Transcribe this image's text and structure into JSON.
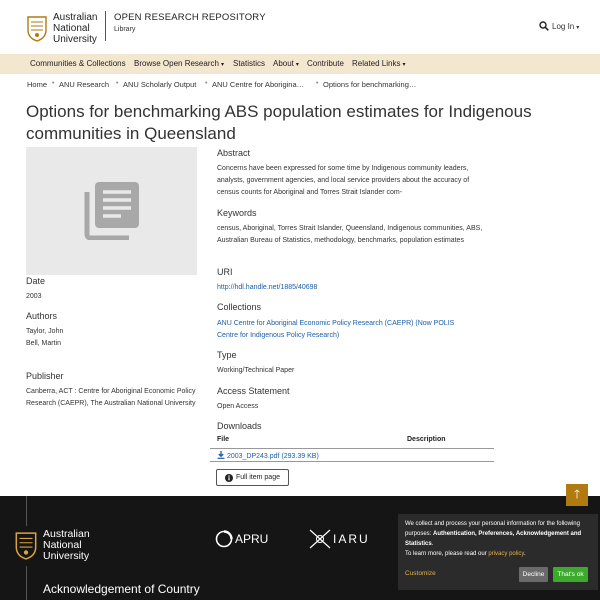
{
  "header": {
    "institution_line1": "Australian",
    "institution_line2": "National",
    "institution_line3": "University",
    "repo_title": "OPEN RESEARCH REPOSITORY",
    "repo_subtitle": "Library",
    "login_label": "Log In"
  },
  "nav": {
    "items": [
      "Communities & Collections",
      "Browse Open Research",
      "Statistics",
      "About",
      "Contribute",
      "Related Links"
    ]
  },
  "breadcrumb": [
    "Home",
    "ANU Research",
    "ANU Scholarly Output",
    "ANU Centre for Aborigina…",
    "Options for benchmarking…"
  ],
  "item": {
    "title": "Options for benchmarking ABS population estimates for Indigenous communities in Queensland",
    "date_label": "Date",
    "date": "2003",
    "authors_label": "Authors",
    "authors": [
      "Taylor, John",
      "Bell, Martin"
    ],
    "publisher_label": "Publisher",
    "publisher": "Canberra, ACT : Centre for Aboriginal Economic Policy Research (CAEPR), The Australian National University",
    "abstract_label": "Abstract",
    "abstract": "Concerns have been expressed for some time by Indigenous community leaders, analysts, government agencies, and local service providers about the accuracy of census counts for Aboriginal and Torres Strait Islander com-",
    "keywords_label": "Keywords",
    "keywords": "census, Aboriginal, Torres Strait Islander, Queensland, Indigenous communities, ABS, Australian Bureau of Statistics, methodology, benchmarks, population estimates",
    "uri_label": "URI",
    "uri": "http://hdl.handle.net/1885/40698",
    "collections_label": "Collections",
    "collection": "ANU Centre for Aboriginal Economic Policy Research (CAEPR) (Now POLIS Centre for Indigenous Policy Research)",
    "type_label": "Type",
    "type": "Working/Technical Paper",
    "access_label": "Access Statement",
    "access": "Open Access",
    "downloads_label": "Downloads",
    "downloads_col_file": "File",
    "downloads_col_desc": "Description",
    "download_file": "2003_DP243.pdf (293.39 KB)",
    "full_item_label": "Full item page"
  },
  "footer": {
    "anu_line1": "Australian",
    "anu_line2": "National",
    "anu_line3": "University",
    "apru": "APRU",
    "iaru": "IARU",
    "acknowledgement": "Acknowledgement of Country"
  },
  "cookie": {
    "text_pre": "We collect and process your personal information for the following purposes: ",
    "text_bold": "Authentication, Preferences, Acknowledgement and Statistics",
    "text_post": ".",
    "learn_pre": "To learn more, please read our ",
    "privacy_link": "privacy policy",
    "learn_post": ".",
    "customize": "Customize",
    "decline": "Decline",
    "accept": "That's ok"
  },
  "colors": {
    "navbar": "#f4e7cf",
    "link": "#1a5fa8",
    "footer": "#151515",
    "accent_gold": "#b07a10",
    "accept_green": "#3cab2c"
  }
}
